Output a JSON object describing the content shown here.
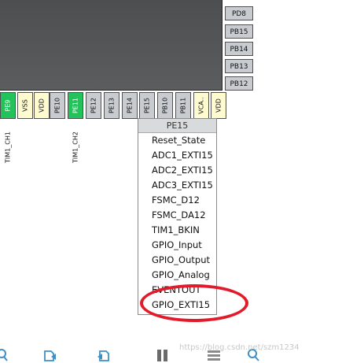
{
  "right_pins": [
    "PD8",
    "PB15",
    "PB14",
    "PB13",
    "PB12"
  ],
  "bottom_pins": [
    "PE9",
    "VSS",
    "VDD",
    "PE10",
    "PE11",
    "PE12",
    "PE13",
    "PE14",
    "PE15",
    "PB10",
    "PB11",
    "VCA..",
    "VDD"
  ],
  "signal_labels": [
    "TIM1_CH1",
    "TIM1_CH2"
  ],
  "menu": {
    "header": "PE15",
    "items": [
      "Reset_State",
      "ADC1_EXTI15",
      "ADC2_EXTI15",
      "ADC3_EXTI15",
      "FSMC_D12",
      "FSMC_DA12",
      "TIM1_BKIN",
      "GPIO_Input",
      "GPIO_Output",
      "GPIO_Analog",
      "EVENTOUT",
      "GPIO_EXTI15"
    ]
  },
  "watermark": "https://blog.csdn.net/szm1234",
  "colors": {
    "chip": "#4f5153",
    "pin_gray": "#c8ccd0",
    "pin_green": "#22c35a",
    "pin_yellow": "#fffbd0",
    "highlight": "#e11b2a",
    "toolbar_icon": "#3f8fc7"
  },
  "toolbar_icons": [
    "zoom-icon",
    "export-icon",
    "import-icon",
    "split-icon",
    "grid-icon",
    "search-icon"
  ]
}
